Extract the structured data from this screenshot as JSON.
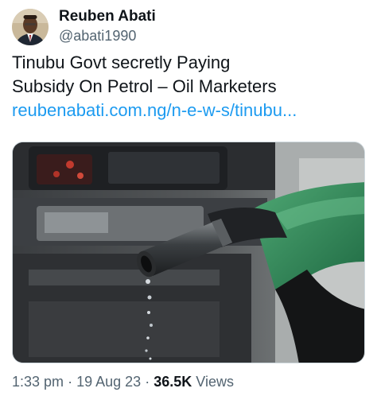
{
  "author": {
    "display_name": "Reuben Abati",
    "handle": "@abati1990"
  },
  "tweet": {
    "text_line1": "Tinubu Govt secretly Paying",
    "text_line2": "Subsidy On Petrol – Oil Marketers",
    "link": "reubenabati.com.ng/n-e-w-s/tinubu..."
  },
  "media": {
    "icon": "fuel-nozzle-photo"
  },
  "meta": {
    "time": "1:33 pm",
    "separator": "·",
    "date": "19 Aug 23",
    "views_count": "36.5K",
    "views_label": "Views"
  },
  "colors": {
    "link": "#1d9bf0",
    "secondary_text": "#536471",
    "primary_text": "#0f1419"
  }
}
